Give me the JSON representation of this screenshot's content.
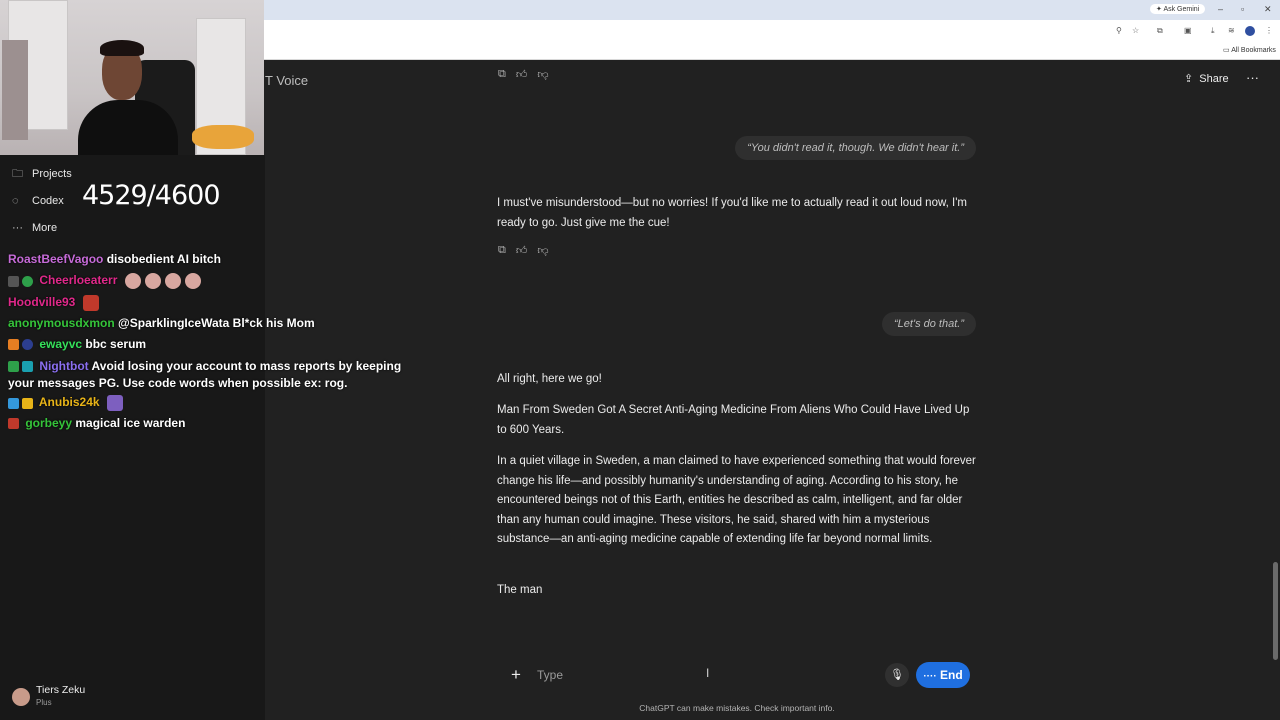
{
  "browser": {
    "ask_gemini": "Ask Gemini",
    "bookmarks_label": "All Bookmarks"
  },
  "stream": {
    "counter": "4529/4600"
  },
  "sidebar": {
    "items": [
      {
        "label": "Projects",
        "icon": "folder-icon"
      },
      {
        "label": "Codex",
        "icon": "codex-icon"
      },
      {
        "label": "More",
        "icon": "more-dots-icon"
      }
    ],
    "user": {
      "name": "Tiers Zeku",
      "plan": "Plus"
    }
  },
  "chat_overlay": {
    "messages": [
      {
        "user": "RoastBeefVagoo",
        "text": "disobedient AI bitch",
        "color": "#c66bd8"
      },
      {
        "user": "Cheerloeaterr",
        "text": "",
        "color": "#e0288a"
      },
      {
        "user": "Hoodville93",
        "text": "",
        "color": "#e0288a"
      },
      {
        "user": "anonymousdxmon",
        "text": "@SparklingIceWata Bl*ck his Mom",
        "color": "#35c43a"
      },
      {
        "user": "ewayvc",
        "text": "bbc serum",
        "color": "#35e05a"
      },
      {
        "user": "Nightbot",
        "text": "Avoid losing your account to mass reports by keeping",
        "text2": "your messages PG. Use code words when possible ex: rog.",
        "color": "#8b6ff0"
      },
      {
        "user": "Anubis24k",
        "text": "",
        "color": "#e8b418"
      },
      {
        "user": "gorbeyy",
        "text": "magical ice warden",
        "color": "#35c43a"
      }
    ]
  },
  "header": {
    "title_fragment": "T Voice",
    "share_label": "Share"
  },
  "conversation": {
    "user_msg_1": "“You didn't read it, though. We didn't hear it.”",
    "assistant_msg_1": "I must've misunderstood—but no worries! If you'd like me to actually read it out loud now, I'm ready to go. Just give me the cue!",
    "user_msg_2": "“Let's do that.”",
    "assistant_msg_2": {
      "intro": "All right, here we go!",
      "headline": "Man From Sweden Got A Secret Anti-Aging Medicine From Aliens Who Could Have Lived Up to 600 Years.",
      "body": "In a quiet village in Sweden, a man claimed to have experienced something that would forever change his life—and possibly humanity's understanding of aging. According to his story, he encountered beings not of this Earth, entities he described as calm, intelligent, and far older than any human could imagine. These visitors, he said, shared with him a mysterious substance—an anti-aging medicine capable of extending life far beyond normal limits.",
      "partial": "The man"
    }
  },
  "composer": {
    "placeholder": "Type",
    "end_label": "End",
    "disclaimer": "ChatGPT can make mistakes. Check important info."
  },
  "colors": {
    "background": "#212121",
    "sidebar": "#181818",
    "end_button": "#1f6fe0"
  }
}
